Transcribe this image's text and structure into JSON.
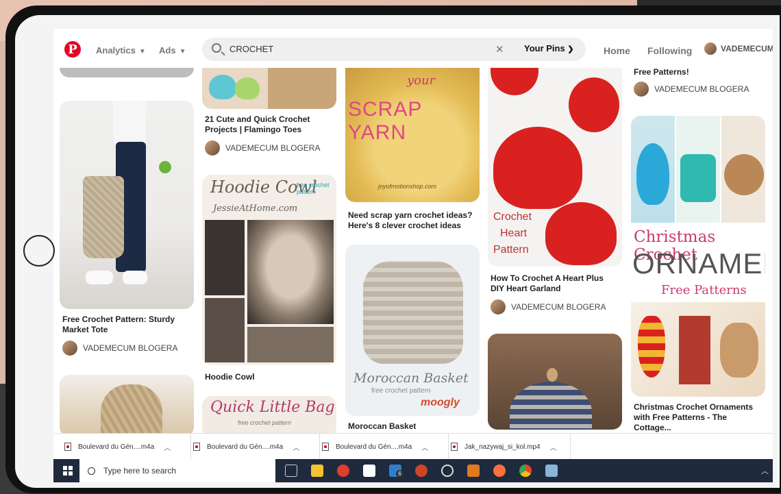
{
  "header": {
    "logo": "P",
    "nav_analytics": "Analytics",
    "nav_ads": "Ads",
    "search_value": "CROCHET",
    "search_clear": "✕",
    "your_pins": "Your Pins",
    "nav_home": "Home",
    "nav_following": "Following",
    "user_name": "VADEMECUM"
  },
  "pins": {
    "col1": [
      {
        "title": "Free Crochet Pattern: Sturdy Market Tote",
        "author": "VADEMECUM BLOGERA"
      }
    ],
    "col2": [
      {
        "title": "21 Cute and Quick Crochet Projects | Flamingo Toes",
        "author": "VADEMECUM BLOGERA"
      },
      {
        "title": "Hoodie Cowl",
        "overlay_title": "Hoodie Cowl",
        "overlay_sub": "JessieAtHome.com",
        "overlay_note": "free crochet pattern"
      },
      {
        "overlay_title": "Quick Little Bag",
        "overlay_sub": "free crochet pattern"
      }
    ],
    "col3": [
      {
        "title": "Need scrap yarn crochet ideas? Here's 8 clever crochet ideas",
        "overlay_top": "your",
        "overlay_title": "SCRAP YARN",
        "overlay_sub": "joyofmotionshop.com"
      },
      {
        "title": "Moroccan Basket",
        "overlay_title": "Moroccan Basket",
        "overlay_sub": "free crochet pattern",
        "overlay_brand": "moogly"
      }
    ],
    "col4": [
      {
        "title": "How To Crochet A Heart Plus DIY Heart Garland",
        "author": "VADEMECUM BLOGERA",
        "overlay_text": [
          "Crochet",
          "Heart",
          "Pattern"
        ]
      },
      {}
    ],
    "col5": [
      {
        "title": "Free Patterns!",
        "author": "VADEMECUM BLOGERA"
      },
      {
        "title": "Christmas Crochet Ornaments with Free Patterns - The Cottage...",
        "overlay_title": "Christmas Crochet",
        "overlay_big": "ORNAMENTS",
        "overlay_sub": "Free Patterns"
      }
    ]
  },
  "downloads": [
    {
      "name": "Boulevard du Gén....m4a"
    },
    {
      "name": "Boulevard du Gén....m4a"
    },
    {
      "name": "Boulevard du Gén....m4a"
    },
    {
      "name": "Jak_nazywaj_si_kol.mp4"
    }
  ],
  "taskbar": {
    "search_placeholder": "Type here to search",
    "badge": "6"
  },
  "colors": {
    "brand": "#e60023",
    "taskbar": "#1f2a3d"
  }
}
